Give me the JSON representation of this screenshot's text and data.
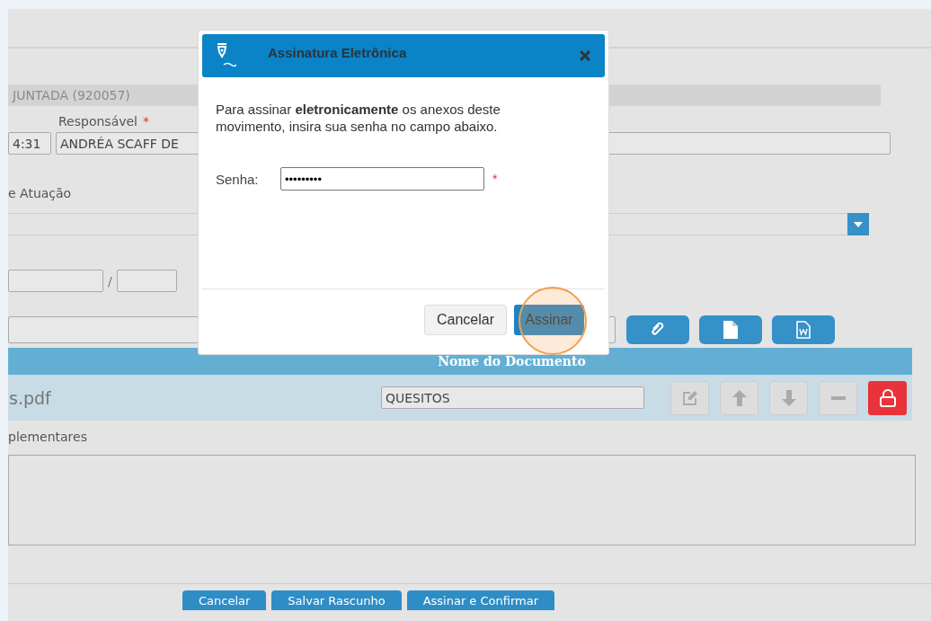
{
  "form": {
    "section_bar": "JUNTADA (920057)",
    "responsible_label": "Responsável",
    "required_mark": "*",
    "time_value": "4:31",
    "responsible_value": "ANDRÉA SCAFF DE",
    "area_label": "e Atuação",
    "separator": "/",
    "attach_buttons": [
      {
        "kind": "clip"
      },
      {
        "kind": "file"
      },
      {
        "kind": "word"
      }
    ]
  },
  "documents": {
    "column_header": "Nome do Documento",
    "rows": [
      {
        "file": "s.pdf",
        "name": "QUESITOS",
        "actions": [
          {
            "kind": "edit"
          },
          {
            "kind": "up"
          },
          {
            "kind": "down"
          },
          {
            "kind": "remove"
          },
          {
            "kind": "lock"
          }
        ]
      }
    ]
  },
  "notes": {
    "label": "plementares"
  },
  "footer_buttons": [
    "Cancelar",
    "Salvar Rascunho",
    "Assinar e Confirmar"
  ],
  "dialog": {
    "title": "Assinatura Eletrônica",
    "message": "Para assinar **eletronicamente** os anexos deste movimento, insira sua senha no campo abaixo.",
    "password_label": "Senha:",
    "password_value": "•••••••••",
    "required_mark": "*",
    "buttons": [
      {
        "label": "Cancelar",
        "kind": "secondary",
        "highlighted": false
      },
      {
        "label": "Assinar",
        "kind": "primary",
        "highlighted": true
      }
    ]
  }
}
